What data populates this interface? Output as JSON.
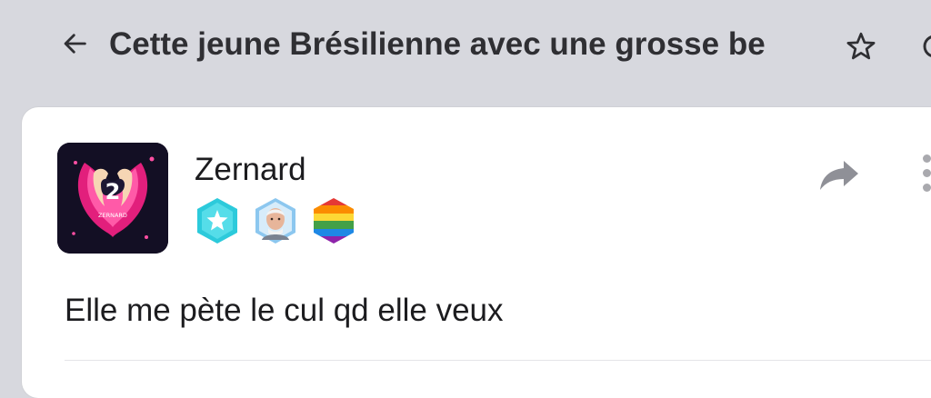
{
  "header": {
    "title": "Cette jeune Brésilienne avec une grosse be",
    "back_icon": "arrow-left-icon",
    "star_icon": "star-outline-icon",
    "more_icon": "more-icon"
  },
  "post": {
    "author": {
      "name": "Zernard",
      "avatar_caption": "ZERNARD"
    },
    "badges": [
      {
        "name": "star-badge",
        "color": "#29c5d6"
      },
      {
        "name": "harold-badge",
        "color": "#6fb7e8"
      },
      {
        "name": "rainbow-badge",
        "color": "#e53935"
      }
    ],
    "share_icon": "share-arrow-icon",
    "more_icon": "vertical-dots-icon",
    "text": "Elle me pète le cul qd elle veux"
  },
  "colors": {
    "background": "#d7d8de",
    "card": "#ffffff",
    "text": "#1c1c1f",
    "icon_gray": "#8f9097"
  }
}
